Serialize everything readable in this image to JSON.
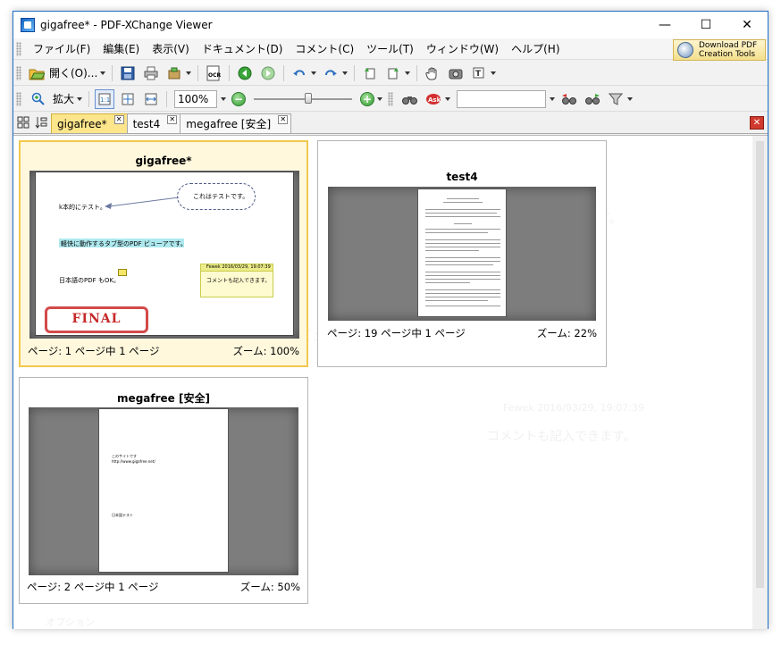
{
  "window": {
    "title": "gigafree* - PDF-XChange Viewer",
    "minimize": "—",
    "maximize": "☐",
    "close": "✕"
  },
  "menu": {
    "items": [
      "ファイル(F)",
      "編集(E)",
      "表示(V)",
      "ドキュメント(D)",
      "コメント(C)",
      "ツール(T)",
      "ウィンドウ(W)",
      "ヘルプ(H)"
    ],
    "download_label_line1": "Download PDF",
    "download_label_line2": "Creation Tools"
  },
  "toolbar1": {
    "open_label": "開く(O)...",
    "ocr_label": "OCR"
  },
  "toolbar2": {
    "zoom_label": "拡大",
    "zoom_value": "100%"
  },
  "tabs": {
    "items": [
      {
        "label": "gigafree*",
        "active": true
      },
      {
        "label": "test4",
        "active": false
      },
      {
        "label": "megafree [安全]",
        "active": false
      }
    ],
    "close_glyph": "✕"
  },
  "thumbnails": [
    {
      "title": "gigafree*",
      "page_info": "ページ: 1 ページ中 1 ページ",
      "zoom_info": "ズーム: 100%",
      "content": {
        "cloud_text": "これはテストです。",
        "arrow_label": "k本的にテスト。",
        "highlight_text": "軽快に動作するタブ型のPDF ビューアです。",
        "body_text": "日本語のPDF もOK。",
        "note_head": "Fewek 2016/03/29, 19:07:39",
        "note_text": "コメントも記入できます。",
        "stamp_text": "FINAL"
      }
    },
    {
      "title": "test4",
      "page_info": "ページ: 19 ページ中 1 ページ",
      "zoom_info": "ズーム: 22%"
    },
    {
      "title": "megafree [安全]",
      "page_info": "ページ: 2 ページ中 1 ページ",
      "zoom_info": "ズーム: 50%",
      "content": {
        "line1": "このサイトです",
        "line2": "http://www.gigafree.net/",
        "line3": "日本語テスト"
      }
    }
  ],
  "background_overlay": {
    "cloud_text": "これはテストです。",
    "arrow_label": "k本的にテスト。",
    "highlight_text": "軽快に動作するタブ型のPDF ビューアです。",
    "body_text": "日本語のPDF もOK。",
    "note_head": "Fewek 2016/03/29, 19:07:39",
    "note_text": "コメントも記入できます。",
    "stamp_text": "FINAL",
    "bottom_label": "オプション"
  },
  "colors": {
    "accent": "#1d6fc7",
    "active_tab": "#fde58b",
    "stamp_red": "#c62828"
  }
}
